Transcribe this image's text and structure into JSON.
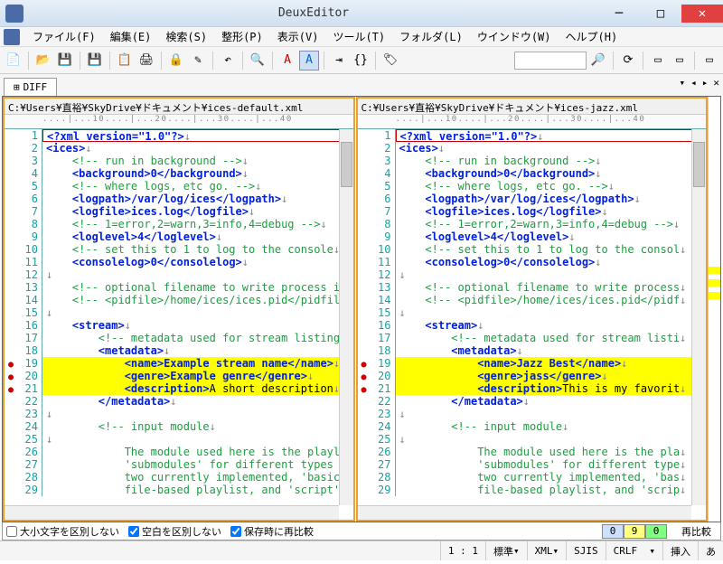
{
  "window": {
    "title": "DeuxEditor"
  },
  "menu": {
    "file": "ファイル(F)",
    "edit": "編集(E)",
    "search": "検索(S)",
    "format": "整形(P)",
    "view": "表示(V)",
    "tool": "ツール(T)",
    "folder": "フォルダ(L)",
    "window": "ウインドウ(W)",
    "help": "ヘルプ(H)"
  },
  "tab": {
    "label": "DIFF"
  },
  "left": {
    "path": "C:¥Users¥直裕¥SkyDrive¥ドキュメント¥ices-default.xml",
    "lines": [
      {
        "n": 1,
        "t": "<?xml version=\"1.0\"?>",
        "ty": "pi",
        "box": true
      },
      {
        "n": 2,
        "t": "<ices>",
        "ty": "tag"
      },
      {
        "n": 3,
        "t": "    <!-- run in background -->",
        "ty": "cmt"
      },
      {
        "n": 4,
        "t": "    <background>0</background>",
        "ty": "tag"
      },
      {
        "n": 5,
        "t": "    <!-- where logs, etc go. -->",
        "ty": "cmt"
      },
      {
        "n": 6,
        "t": "    <logpath>/var/log/ices</logpath>",
        "ty": "tag"
      },
      {
        "n": 7,
        "t": "    <logfile>ices.log</logfile>",
        "ty": "tag"
      },
      {
        "n": 8,
        "t": "    <!-- 1=error,2=warn,3=info,4=debug -->",
        "ty": "cmt"
      },
      {
        "n": 9,
        "t": "    <loglevel>4</loglevel>",
        "ty": "tag"
      },
      {
        "n": 10,
        "t": "    <!-- set this to 1 to log to the console",
        "ty": "cmt"
      },
      {
        "n": 11,
        "t": "    <consolelog>0</consolelog>",
        "ty": "tag"
      },
      {
        "n": 12,
        "t": "",
        "ty": ""
      },
      {
        "n": 13,
        "t": "    <!-- optional filename to write process i",
        "ty": "cmt"
      },
      {
        "n": 14,
        "t": "    <!-- <pidfile>/home/ices/ices.pid</pidfil",
        "ty": "cmt"
      },
      {
        "n": 15,
        "t": "",
        "ty": ""
      },
      {
        "n": 16,
        "t": "    <stream>",
        "ty": "tag"
      },
      {
        "n": 17,
        "t": "        <!-- metadata used for stream listing",
        "ty": "cmt"
      },
      {
        "n": 18,
        "t": "        <metadata>",
        "ty": "tag"
      },
      {
        "n": 19,
        "t": "            <name>Example stream name</name>",
        "ty": "tag",
        "hl": true,
        "dot": true
      },
      {
        "n": 20,
        "t": "            <genre>Example genre</genre>",
        "ty": "tag",
        "hl": true,
        "dot": true
      },
      {
        "n": 21,
        "t": "            <description>A short description",
        "ty": "tag",
        "hl": true,
        "dot": true
      },
      {
        "n": 22,
        "t": "        </metadata>",
        "ty": "tag"
      },
      {
        "n": 23,
        "t": "",
        "ty": ""
      },
      {
        "n": 24,
        "t": "        <!-- input module",
        "ty": "cmt"
      },
      {
        "n": 25,
        "t": "",
        "ty": "cmt"
      },
      {
        "n": 26,
        "t": "            The module used here is the playl",
        "ty": "cmt"
      },
      {
        "n": 27,
        "t": "            'submodules' for different types ",
        "ty": "cmt"
      },
      {
        "n": 28,
        "t": "            two currently implemented, 'basic",
        "ty": "cmt"
      },
      {
        "n": 29,
        "t": "            file-based playlist, and 'script'",
        "ty": "cmt"
      }
    ]
  },
  "right": {
    "path": "C:¥Users¥直裕¥SkyDrive¥ドキュメント¥ices-jazz.xml",
    "lines": [
      {
        "n": 1,
        "t": "<?xml version=\"1.0\"?>",
        "ty": "pi",
        "box": true
      },
      {
        "n": 2,
        "t": "<ices>",
        "ty": "tag"
      },
      {
        "n": 3,
        "t": "    <!-- run in background -->",
        "ty": "cmt"
      },
      {
        "n": 4,
        "t": "    <background>0</background>",
        "ty": "tag"
      },
      {
        "n": 5,
        "t": "    <!-- where logs, etc go. -->",
        "ty": "cmt"
      },
      {
        "n": 6,
        "t": "    <logpath>/var/log/ices</logpath>",
        "ty": "tag"
      },
      {
        "n": 7,
        "t": "    <logfile>ices.log</logfile>",
        "ty": "tag"
      },
      {
        "n": 8,
        "t": "    <!-- 1=error,2=warn,3=info,4=debug -->",
        "ty": "cmt"
      },
      {
        "n": 9,
        "t": "    <loglevel>4</loglevel>",
        "ty": "tag"
      },
      {
        "n": 10,
        "t": "    <!-- set this to 1 to log to the consol",
        "ty": "cmt"
      },
      {
        "n": 11,
        "t": "    <consolelog>0</consolelog>",
        "ty": "tag"
      },
      {
        "n": 12,
        "t": "",
        "ty": ""
      },
      {
        "n": 13,
        "t": "    <!-- optional filename to write process",
        "ty": "cmt"
      },
      {
        "n": 14,
        "t": "    <!-- <pidfile>/home/ices/ices.pid</pidf",
        "ty": "cmt"
      },
      {
        "n": 15,
        "t": "",
        "ty": ""
      },
      {
        "n": 16,
        "t": "    <stream>",
        "ty": "tag"
      },
      {
        "n": 17,
        "t": "        <!-- metadata used for stream listi",
        "ty": "cmt"
      },
      {
        "n": 18,
        "t": "        <metadata>",
        "ty": "tag"
      },
      {
        "n": 19,
        "t": "            <name>Jazz Best</name>",
        "ty": "tag",
        "hl": true,
        "dot": true
      },
      {
        "n": 20,
        "t": "            <genre>jass</genre>",
        "ty": "tag",
        "hl": true,
        "dot": true
      },
      {
        "n": 21,
        "t": "            <description>This is my favorit",
        "ty": "tag",
        "hl": true,
        "dot": true
      },
      {
        "n": 22,
        "t": "        </metadata>",
        "ty": "tag"
      },
      {
        "n": 23,
        "t": "",
        "ty": ""
      },
      {
        "n": 24,
        "t": "        <!-- input module",
        "ty": "cmt"
      },
      {
        "n": 25,
        "t": "",
        "ty": "cmt"
      },
      {
        "n": 26,
        "t": "            The module used here is the pla",
        "ty": "cmt"
      },
      {
        "n": 27,
        "t": "            'submodules' for different type",
        "ty": "cmt"
      },
      {
        "n": 28,
        "t": "            two currently implemented, 'bas",
        "ty": "cmt"
      },
      {
        "n": 29,
        "t": "            file-based playlist, and 'scrip",
        "ty": "cmt"
      }
    ]
  },
  "opts": {
    "case": "大小文字を区別しない",
    "space": "空白を区別しない",
    "save": "保存時に再比較",
    "cnt_b": "0",
    "cnt_y": "9",
    "cnt_g": "0",
    "recomp": "再比較"
  },
  "status": {
    "pos": "1 : 1",
    "std": "標準",
    "lang": "XML",
    "enc": "SJIS",
    "eol": "CRLF",
    "ins": "挿入",
    "ime": "あ"
  },
  "ruler": "....|...10....|...20....|...30....|...40"
}
